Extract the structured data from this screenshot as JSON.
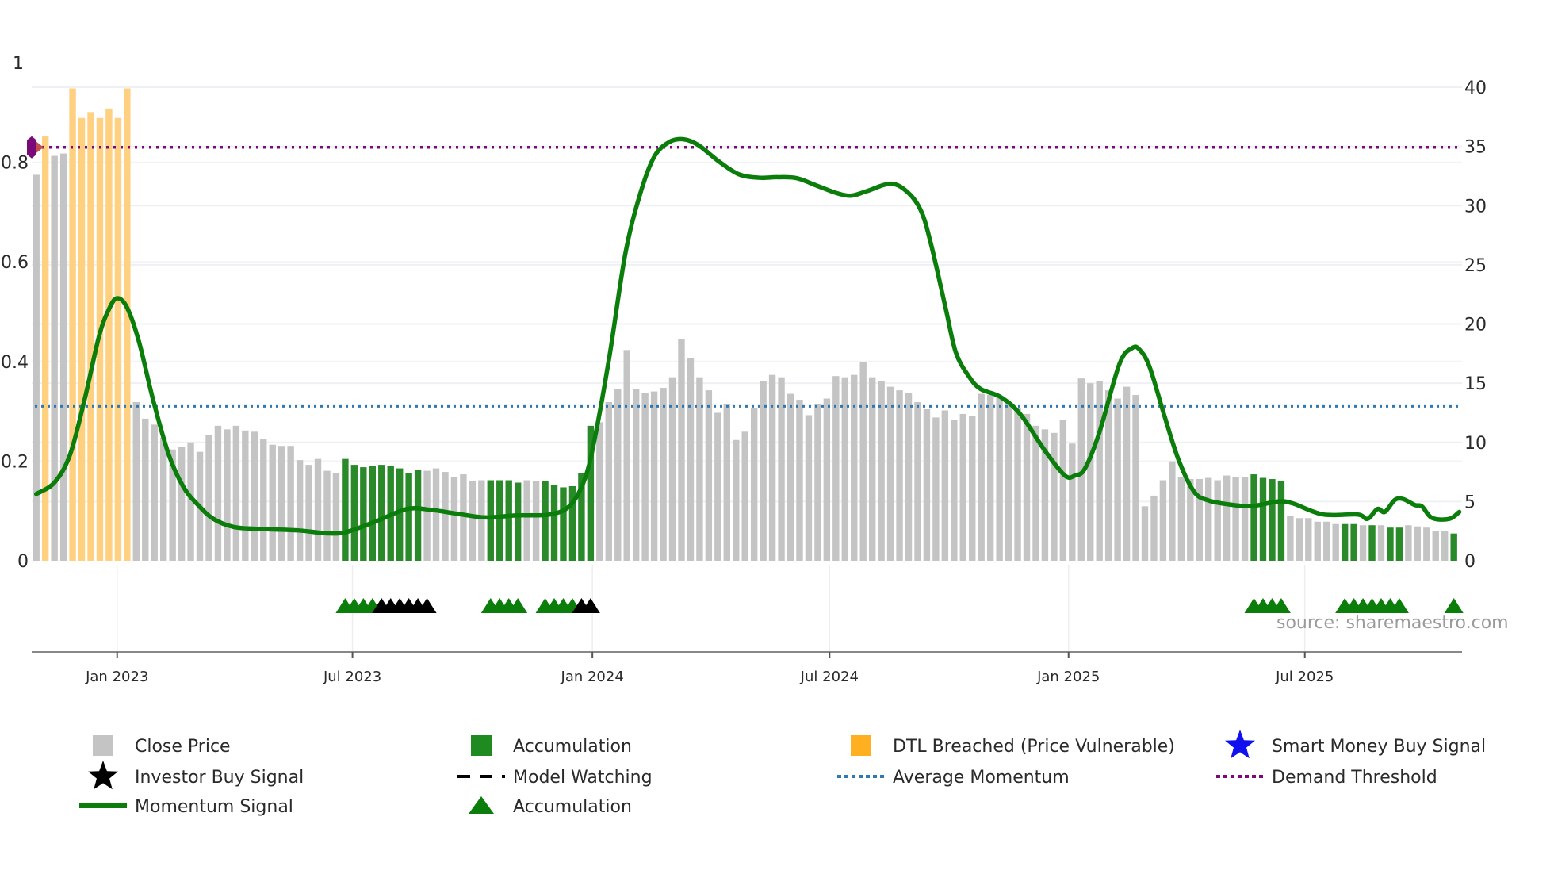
{
  "chart_data": {
    "type": "bar",
    "title": "",
    "source": "source: sharemaestro.com",
    "x_unit": "week index",
    "xlim": [
      -0.5,
      156.9
    ],
    "left_axis": {
      "ylim": [
        0,
        1
      ],
      "ticks": [
        0,
        0.2,
        0.4,
        0.6,
        0.8,
        1
      ],
      "tick_labels": [
        "0",
        "0.2",
        "0.4",
        "0.6",
        "0.8",
        "1"
      ]
    },
    "right_axis": {
      "ylim": [
        0,
        40
      ],
      "ticks": [
        0,
        5,
        10,
        15,
        20,
        25,
        30,
        35,
        40
      ],
      "tick_labels": [
        "0",
        "5",
        "10",
        "15",
        "20",
        "25",
        "30",
        "35",
        "40"
      ]
    },
    "x_ticks": [
      {
        "label": "Jan 2023",
        "x": 8.9
      },
      {
        "label": "Jul 2023",
        "x": 34.8
      },
      {
        "label": "Jan 2024",
        "x": 61.2
      },
      {
        "label": "Jul 2024",
        "x": 87.3
      },
      {
        "label": "Jan 2025",
        "x": 113.6
      },
      {
        "label": "Jul 2025",
        "x": 139.6
      }
    ],
    "close_price": [
      32.6,
      35.9,
      34.2,
      34.4,
      39.9,
      37.4,
      37.9,
      37.4,
      38.2,
      37.4,
      39.9,
      13.4,
      12.0,
      11.5,
      10.4,
      9.4,
      9.6,
      10.0,
      9.2,
      10.6,
      11.4,
      11.1,
      11.4,
      11.0,
      10.9,
      10.3,
      9.8,
      9.7,
      9.7,
      8.5,
      8.1,
      8.6,
      7.6,
      7.4,
      8.6,
      8.1,
      7.9,
      8.0,
      8.1,
      8.0,
      7.8,
      7.4,
      7.7,
      7.6,
      7.8,
      7.5,
      7.1,
      7.3,
      6.7,
      6.8,
      6.8,
      6.8,
      6.8,
      6.6,
      6.8,
      6.7,
      6.7,
      6.4,
      6.2,
      6.3,
      7.4,
      11.4,
      11.7,
      13.4,
      14.5,
      17.8,
      14.5,
      14.2,
      14.3,
      14.6,
      15.5,
      18.7,
      17.1,
      15.5,
      14.4,
      12.5,
      13.2,
      10.2,
      10.9,
      12.9,
      15.2,
      15.7,
      15.5,
      14.1,
      13.6,
      12.3,
      13.2,
      13.7,
      15.6,
      15.5,
      15.7,
      16.8,
      15.5,
      15.2,
      14.7,
      14.4,
      14.2,
      13.4,
      12.8,
      12.1,
      12.7,
      11.9,
      12.4,
      12.2,
      14.1,
      14.0,
      13.9,
      13.3,
      12.9,
      12.4,
      11.4,
      11.1,
      10.8,
      11.9,
      9.9,
      15.4,
      15.0,
      15.2,
      14.4,
      13.7,
      14.7,
      14.0,
      4.6,
      5.5,
      6.8,
      8.4,
      7.1,
      6.9,
      6.9,
      7.0,
      6.8,
      7.2,
      7.1,
      7.1,
      7.3,
      7.0,
      6.9,
      6.7,
      3.8,
      3.6,
      3.6,
      3.3,
      3.3,
      3.1,
      3.1,
      3.1,
      3.0,
      3.0,
      3.0,
      2.8,
      2.8,
      3.0,
      2.9,
      2.8,
      2.5,
      2.5,
      2.3
    ],
    "bar_category_runs": [
      [
        "price",
        1
      ],
      [
        "dtl",
        1
      ],
      [
        "price",
        2
      ],
      [
        "dtl",
        7
      ],
      [
        "price",
        23
      ],
      [
        "accum",
        9
      ],
      [
        "price",
        7
      ],
      [
        "accum",
        4
      ],
      [
        "price",
        2
      ],
      [
        "accum",
        6
      ],
      [
        "price",
        72
      ],
      [
        "accum",
        4
      ],
      [
        "price",
        6
      ],
      [
        "accum",
        2
      ],
      [
        "price",
        1
      ],
      [
        "accum",
        1
      ],
      [
        "price",
        1
      ],
      [
        "accum",
        2
      ],
      [
        "price",
        5
      ],
      [
        "accum",
        1
      ]
    ],
    "momentum": [
      [
        0,
        0.134
      ],
      [
        2.0,
        0.157
      ],
      [
        3.7,
        0.212
      ],
      [
        5.3,
        0.322
      ],
      [
        6.9,
        0.45
      ],
      [
        8.0,
        0.505
      ],
      [
        8.9,
        0.527
      ],
      [
        10.0,
        0.508
      ],
      [
        11.3,
        0.44
      ],
      [
        12.9,
        0.32
      ],
      [
        14.6,
        0.212
      ],
      [
        16.2,
        0.148
      ],
      [
        17.8,
        0.112
      ],
      [
        19.5,
        0.084
      ],
      [
        21.7,
        0.068
      ],
      [
        24.4,
        0.064
      ],
      [
        28.8,
        0.061
      ],
      [
        32.0,
        0.055
      ],
      [
        34.2,
        0.058
      ],
      [
        37.5,
        0.08
      ],
      [
        40.8,
        0.104
      ],
      [
        43.5,
        0.102
      ],
      [
        46.8,
        0.093
      ],
      [
        49.5,
        0.087
      ],
      [
        52.8,
        0.091
      ],
      [
        56.6,
        0.093
      ],
      [
        58.8,
        0.112
      ],
      [
        60.4,
        0.166
      ],
      [
        61.5,
        0.249
      ],
      [
        63.1,
        0.413
      ],
      [
        64.8,
        0.614
      ],
      [
        66.4,
        0.733
      ],
      [
        68.0,
        0.811
      ],
      [
        69.7,
        0.841
      ],
      [
        71.3,
        0.846
      ],
      [
        72.9,
        0.834
      ],
      [
        75.1,
        0.802
      ],
      [
        77.3,
        0.776
      ],
      [
        79.5,
        0.769
      ],
      [
        81.6,
        0.77
      ],
      [
        83.7,
        0.768
      ],
      [
        85.9,
        0.753
      ],
      [
        88.1,
        0.738
      ],
      [
        89.7,
        0.733
      ],
      [
        91.4,
        0.742
      ],
      [
        94.1,
        0.757
      ],
      [
        96.0,
        0.738
      ],
      [
        97.4,
        0.701
      ],
      [
        98.5,
        0.633
      ],
      [
        100.1,
        0.505
      ],
      [
        101.2,
        0.418
      ],
      [
        102.6,
        0.371
      ],
      [
        103.9,
        0.345
      ],
      [
        106.1,
        0.329
      ],
      [
        108.3,
        0.294
      ],
      [
        111.0,
        0.221
      ],
      [
        113.2,
        0.171
      ],
      [
        114.3,
        0.171
      ],
      [
        115.4,
        0.185
      ],
      [
        117.0,
        0.258
      ],
      [
        119.2,
        0.395
      ],
      [
        120.6,
        0.427
      ],
      [
        121.4,
        0.424
      ],
      [
        122.5,
        0.39
      ],
      [
        124.1,
        0.294
      ],
      [
        125.7,
        0.203
      ],
      [
        127.4,
        0.139
      ],
      [
        129.0,
        0.121
      ],
      [
        131.7,
        0.112
      ],
      [
        133.9,
        0.11
      ],
      [
        136.7,
        0.119
      ],
      [
        138.3,
        0.115
      ],
      [
        141.6,
        0.093
      ],
      [
        145.4,
        0.093
      ],
      [
        146.5,
        0.084
      ],
      [
        147.6,
        0.104
      ],
      [
        148.4,
        0.098
      ],
      [
        149.5,
        0.122
      ],
      [
        150.4,
        0.124
      ],
      [
        151.7,
        0.112
      ],
      [
        152.5,
        0.109
      ],
      [
        153.6,
        0.086
      ],
      [
        155.5,
        0.084
      ],
      [
        156.6,
        0.098
      ]
    ],
    "average_momentum": 0.31,
    "demand_threshold": 0.83,
    "accumulation_triangles": [
      34,
      35,
      36,
      37,
      50,
      51,
      52,
      53,
      56,
      57,
      58,
      59,
      134,
      135,
      136,
      137,
      144,
      145,
      146,
      147,
      148,
      149,
      150,
      156
    ],
    "watching_triangles": [
      38,
      39,
      40,
      41,
      42,
      43,
      60,
      61
    ],
    "legend": [
      {
        "label": "Close Price",
        "icon": "gray-square"
      },
      {
        "label": "Accumulation",
        "icon": "green-square"
      },
      {
        "label": "DTL Breached (Price Vulnerable)",
        "icon": "orange-square"
      },
      {
        "label": "Smart Money Buy Signal",
        "icon": "blue-star"
      },
      {
        "label": "Investor Buy Signal",
        "icon": "black-star"
      },
      {
        "label": "Model Watching",
        "icon": "black-dashed-line"
      },
      {
        "label": "Average Momentum",
        "icon": "blue-dotted-line"
      },
      {
        "label": "Demand Threshold",
        "icon": "purple-dotted-line"
      },
      {
        "label": "Momentum Signal",
        "icon": "green-line"
      },
      {
        "label": "Accumulation",
        "icon": "green-triangle"
      }
    ],
    "colors": {
      "price": "#c4c4c4",
      "accum": "#2a8a2a",
      "dtl": "#ffd080",
      "momentum": "#0a7d0a",
      "average": "#2f78b4",
      "threshold": "#7a0a7a",
      "smart": "#1010ee",
      "black": "#000000"
    }
  }
}
